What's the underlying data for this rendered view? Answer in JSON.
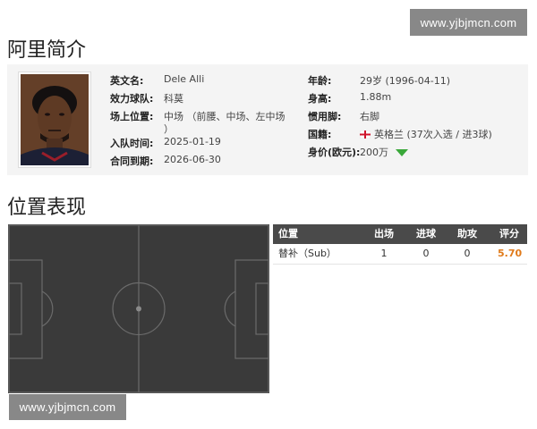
{
  "watermark": "www.yjbjmcn.com",
  "profile": {
    "title": "阿里简介",
    "fields": {
      "english_name_label": "英文名:",
      "english_name": "Dele Alli",
      "club_label": "效力球队:",
      "club": "科莫",
      "position_label": "场上位置:",
      "position_line1": "中场 （前腰、中场、左中场",
      "position_line2": "）",
      "join_label": "入队时间:",
      "join_date": "2025-01-19",
      "contract_label": "合同到期:",
      "contract_date": "2026-06-30",
      "age_label": "年龄:",
      "age": "29岁  (1996-04-11)",
      "height_label": "身高:",
      "height": "1.88m",
      "foot_label": "惯用脚:",
      "foot": "右脚",
      "nation_label": "国籍:",
      "nation": "英格兰 (37次入选 / 进3球)",
      "value_label": "身价(欧元):",
      "value": "200万"
    },
    "icons": [
      "player-photo",
      "england-flag-icon",
      "trend-down-icon"
    ],
    "colors": {
      "trend": "#3aa83a"
    }
  },
  "position_section": {
    "title": "位置表现",
    "table": {
      "headers": [
        "位置",
        "出场",
        "进球",
        "助攻",
        "评分"
      ],
      "rows": [
        [
          "替补（Sub）",
          "1",
          "0",
          "0",
          "5.70"
        ]
      ]
    },
    "colors": {
      "pitch": "#3a3a3a",
      "header": "#4a4a4a",
      "rating": "#e07a1a"
    }
  }
}
